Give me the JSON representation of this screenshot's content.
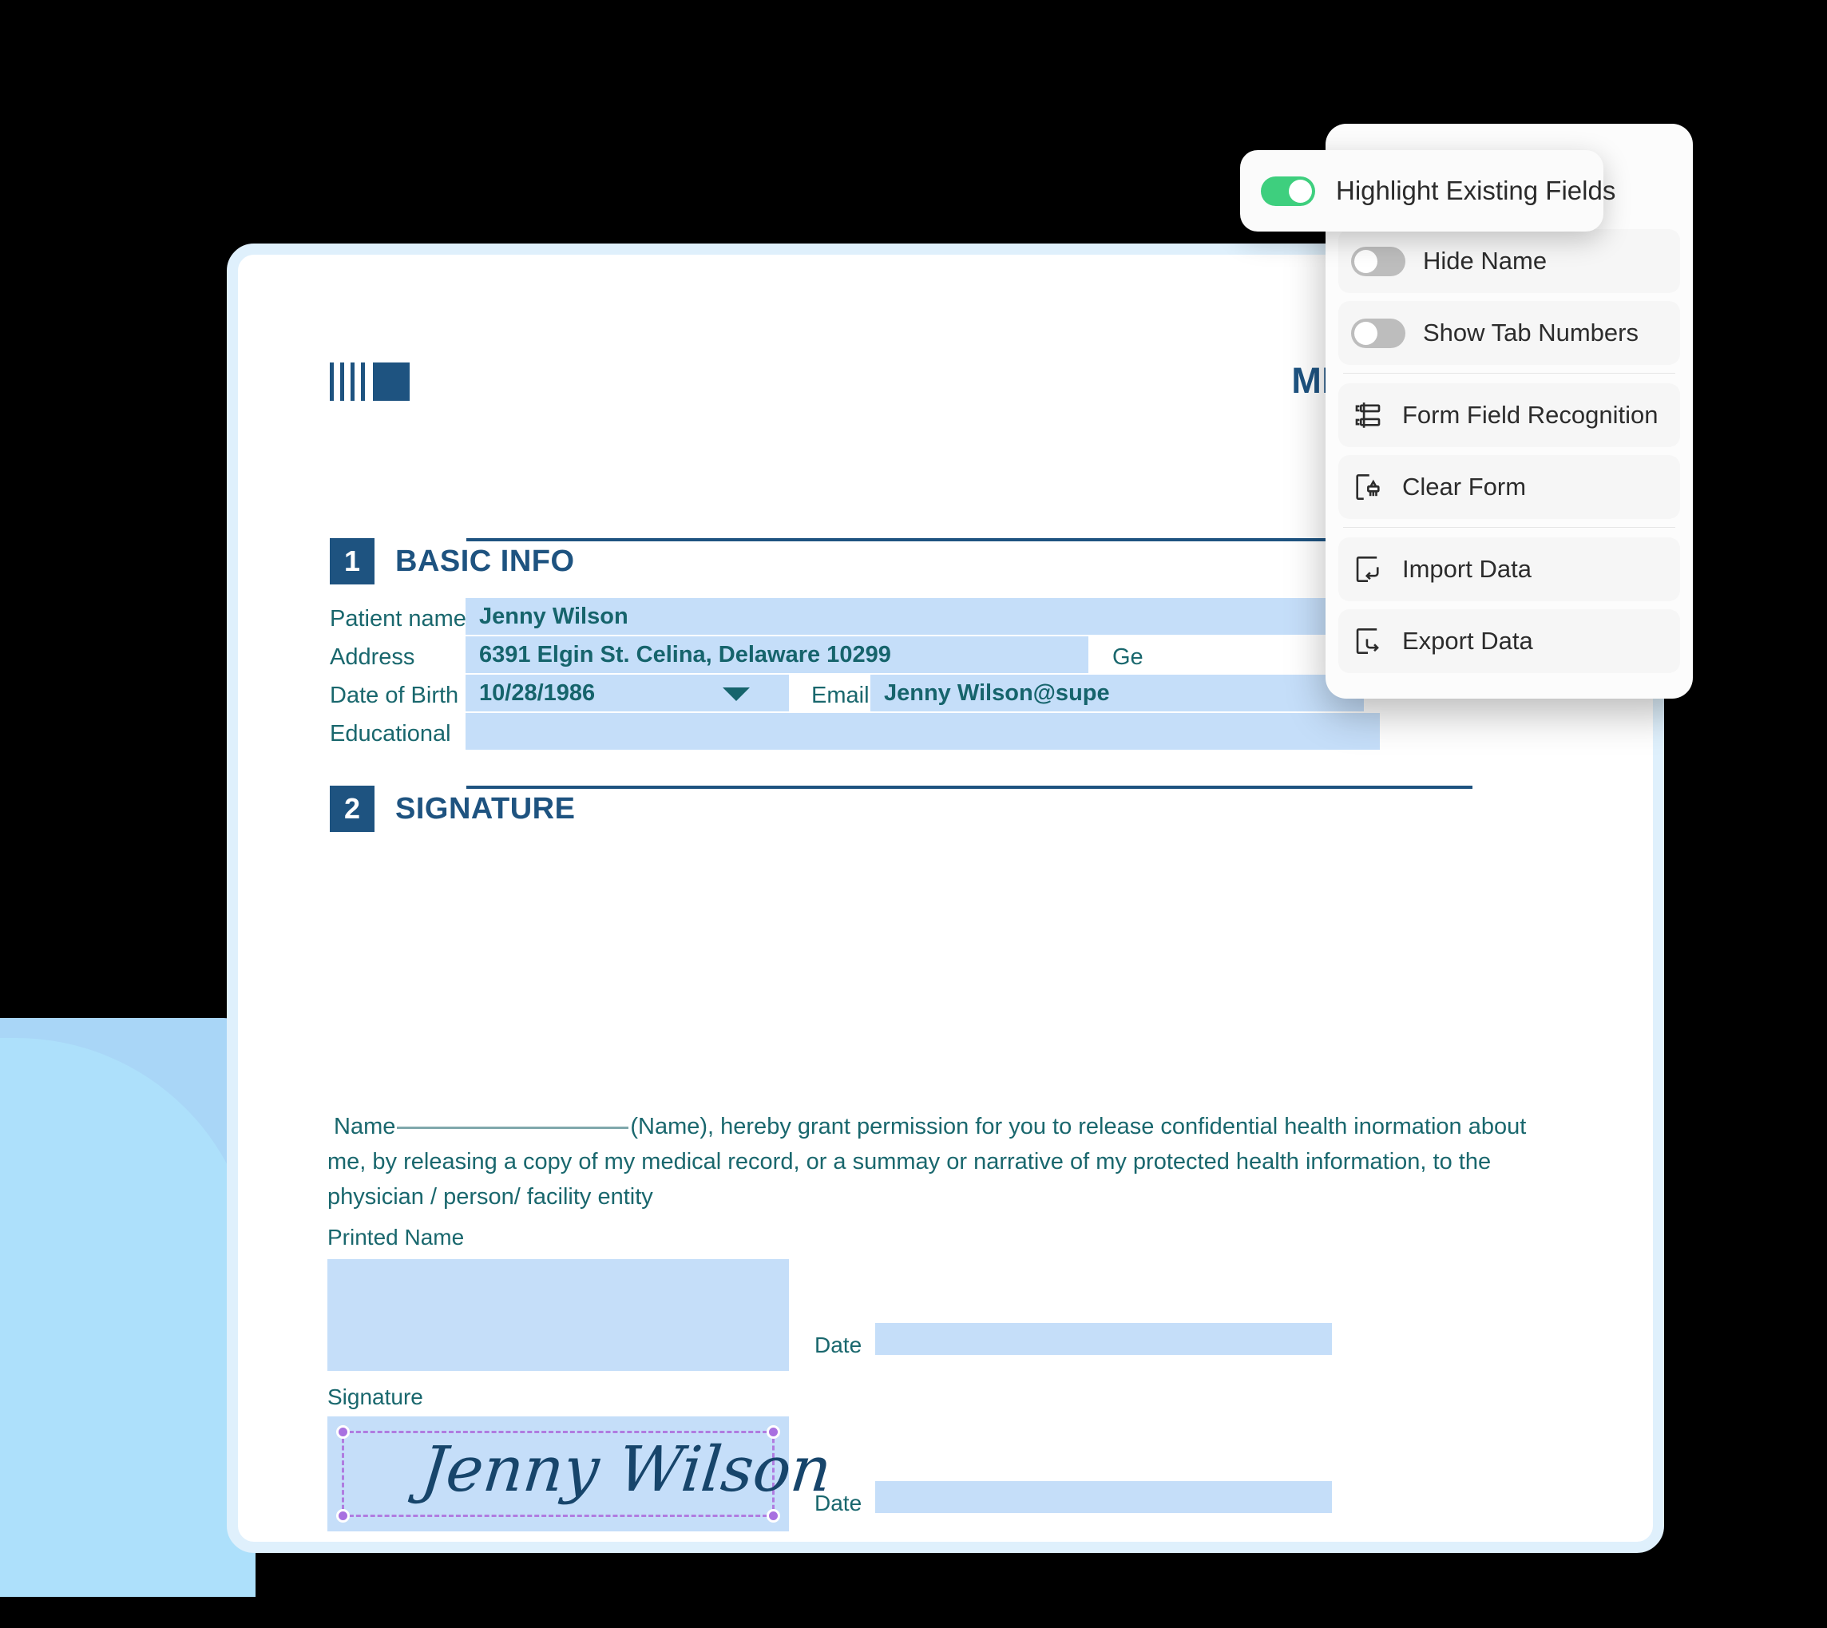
{
  "document": {
    "logo_name": "brand-logo",
    "title": "MEDICAL RELE",
    "sections": [
      {
        "number": "1",
        "title": "BASIC INFO"
      },
      {
        "number": "2",
        "title": "SIGNATURE"
      }
    ],
    "basic_info": {
      "patient_name_label": "Patient name",
      "patient_name_value": "Jenny Wilson",
      "address_label": "Address",
      "address_value": "6391 Elgin St. Celina, Delaware 10299",
      "gender_label": "Ge",
      "dob_label": "Date of Birth",
      "dob_value": "10/28/1986",
      "email_label": "Email",
      "email_value": "Jenny Wilson@supe",
      "educational_label": "Educational",
      "educational_value": ""
    },
    "signature_section": {
      "consent_name_label": "Name",
      "consent_line1": "(Name), hereby grant permission for you to release confidential health inormation",
      "consent_line2": "about me, by releasing a copy of my medical record, or a summay or narrative of my protected health information, to",
      "consent_line3": "the physician / person/ facility entity",
      "printed_name_label": "Printed Name",
      "printed_name_value": "",
      "printed_date_label": "Date",
      "printed_date_value": "",
      "signature_label": "Signature",
      "signature_value": "Jenny Wilson",
      "signature_date_label": "Date",
      "signature_date_value": ""
    }
  },
  "highlight_pill": {
    "label": "Highlight Existing Fields",
    "toggle_state": "on"
  },
  "menu": {
    "toggles": [
      {
        "label": "Hide Name",
        "state": "off",
        "icon": "toggle-icon"
      },
      {
        "label": "Show Tab Numbers",
        "state": "off",
        "icon": "toggle-icon"
      }
    ],
    "actions_group_one": [
      {
        "label": "Form Field Recognition",
        "icon": "form-field-recognition-icon"
      },
      {
        "label": "Clear Form",
        "icon": "clear-form-brush-icon"
      }
    ],
    "actions_group_two": [
      {
        "label": "Import Data",
        "icon": "import-data-icon"
      },
      {
        "label": "Export Data",
        "icon": "export-data-icon"
      }
    ]
  },
  "colors": {
    "brand_navy": "#1e5380",
    "field_fill": "#c5def9",
    "label_teal": "#19676d",
    "toggle_on": "#3ecf7e",
    "toggle_off": "#bdbdbd",
    "selection_purple": "#a870e0",
    "card_border": "#dff0fc",
    "decor_blue": "#ade0fb"
  }
}
